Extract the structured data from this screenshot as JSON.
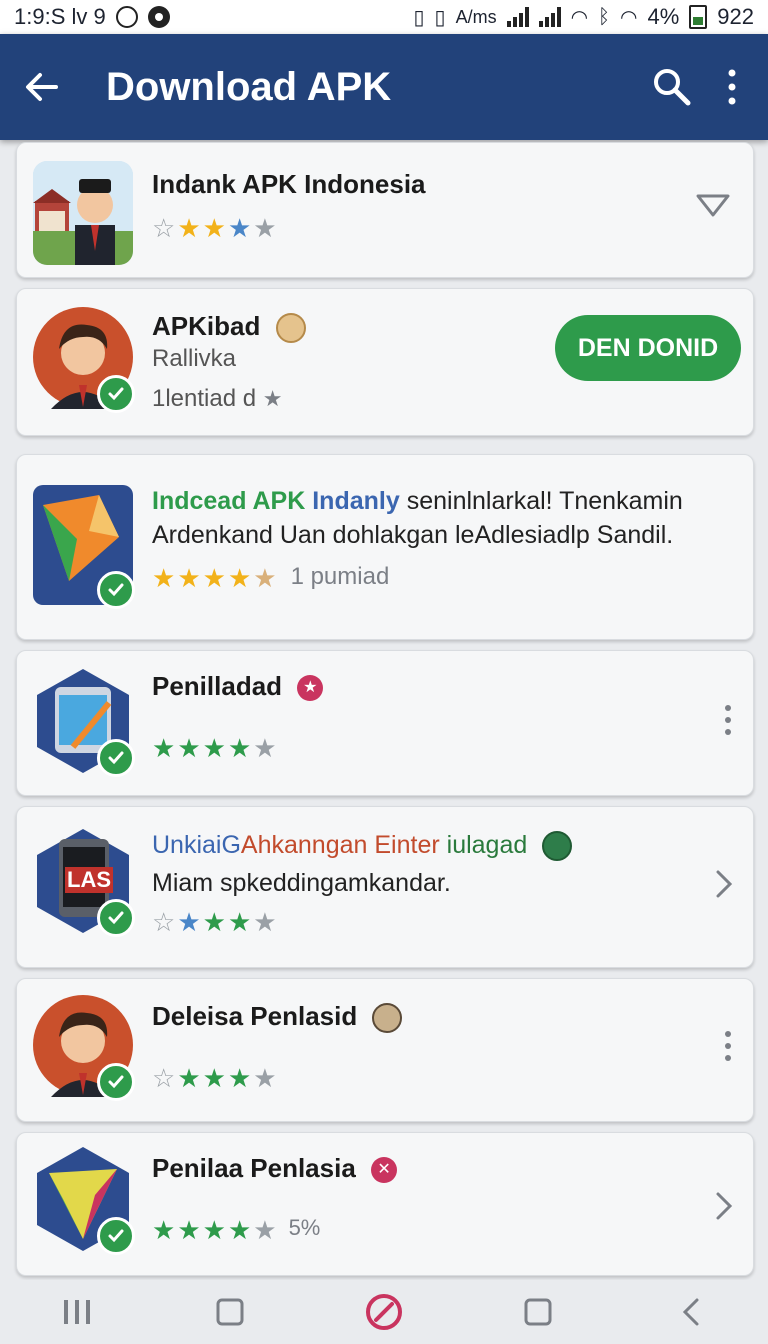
{
  "status_bar": {
    "left_text": "1:9:S lv 9",
    "net_speed": "A/ms",
    "battery_text": "4%",
    "time": "922"
  },
  "app_bar": {
    "title": "Download APK",
    "icons": [
      "back-arrow-icon",
      "search-icon",
      "more-vert-icon"
    ]
  },
  "apps": [
    {
      "title": "Indank APK Indonesia",
      "rating_stars": [
        "empty",
        "gold",
        "gold",
        "blue",
        "gray"
      ],
      "control": "chevron-down-icon"
    },
    {
      "title": "APKibad",
      "subtitle": "Rallivka",
      "meta": "1lentiad d",
      "button_label": "DEN DONID"
    },
    {
      "title_part1": "Indcead APK",
      "title_part2": "Indanly",
      "title_part3": "seninlnlarkal! Tnenkamin",
      "description": "Ardenkand Uan dohlakgan leAdlesiadlp Sandil.",
      "rating_stars": [
        "gold",
        "gold",
        "gold",
        "gold",
        "half"
      ],
      "meta": "1 pumiad"
    },
    {
      "title": "Penilladad",
      "rating_stars": [
        "green",
        "green",
        "green",
        "green",
        "gray"
      ],
      "control": "kebab"
    },
    {
      "title_part1": "UnkiaiG",
      "title_part2": "Ahkanngan Einter",
      "title_part3": "iulagad",
      "subtitle": "Miam spkeddingamkandar.",
      "icon_text": "LAS",
      "rating_stars": [
        "empty",
        "blue",
        "green",
        "green",
        "gray"
      ],
      "control": "chevron-right-icon"
    },
    {
      "title": "Deleisa Penlasid",
      "rating_stars": [
        "empty",
        "green",
        "green",
        "green",
        "gray"
      ],
      "control": "kebab"
    },
    {
      "title": "Penilaa Penlasia",
      "rating_stars": [
        "green",
        "green",
        "green",
        "green",
        "gray"
      ],
      "meta": "5%",
      "control": "chevron-right-icon"
    }
  ],
  "colors": {
    "app_bar": "#22427a",
    "accent_green": "#2e9b4b",
    "star_gold": "#f2b21a",
    "star_blue": "#4a86c8",
    "star_green": "#2e9b4b",
    "star_gray": "#9aa0a6"
  },
  "nav_bar": {
    "icons": [
      "recent-apps-icon",
      "home-square-icon",
      "assistant-icon",
      "overview-square-icon",
      "back-icon"
    ]
  }
}
